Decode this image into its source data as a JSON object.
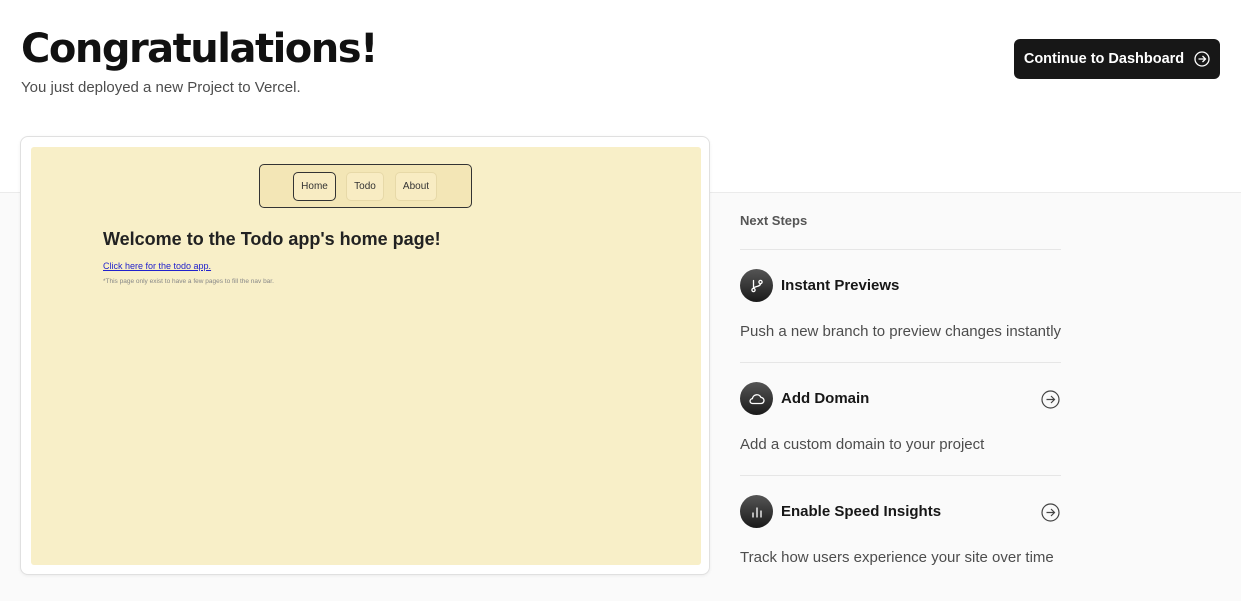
{
  "header": {
    "title": "Congratulations!",
    "subtitle": "You just deployed a new Project to Vercel.",
    "cta_label": "Continue to Dashboard"
  },
  "preview": {
    "nav": [
      "Home",
      "Todo",
      "About"
    ],
    "active_nav": "Home",
    "heading": "Welcome to the Todo app's home page!",
    "link": "Click here for the todo app.",
    "note": "*This page only exist to have a few pages to fill the nav bar."
  },
  "next_steps": {
    "label": "Next Steps",
    "items": [
      {
        "title": "Instant Previews",
        "desc": "Push a new branch to preview changes instantly",
        "icon": "git-branch-icon"
      },
      {
        "title": "Add Domain",
        "desc": "Add a custom domain to your project",
        "icon": "cloud-icon"
      },
      {
        "title": "Enable Speed Insights",
        "desc": "Track how users experience your site over time",
        "icon": "bar-chart-icon"
      }
    ]
  },
  "colors": {
    "cta_bg": "#171717",
    "preview_bg": "#f8efc8",
    "band_bg": "#fafafa"
  }
}
